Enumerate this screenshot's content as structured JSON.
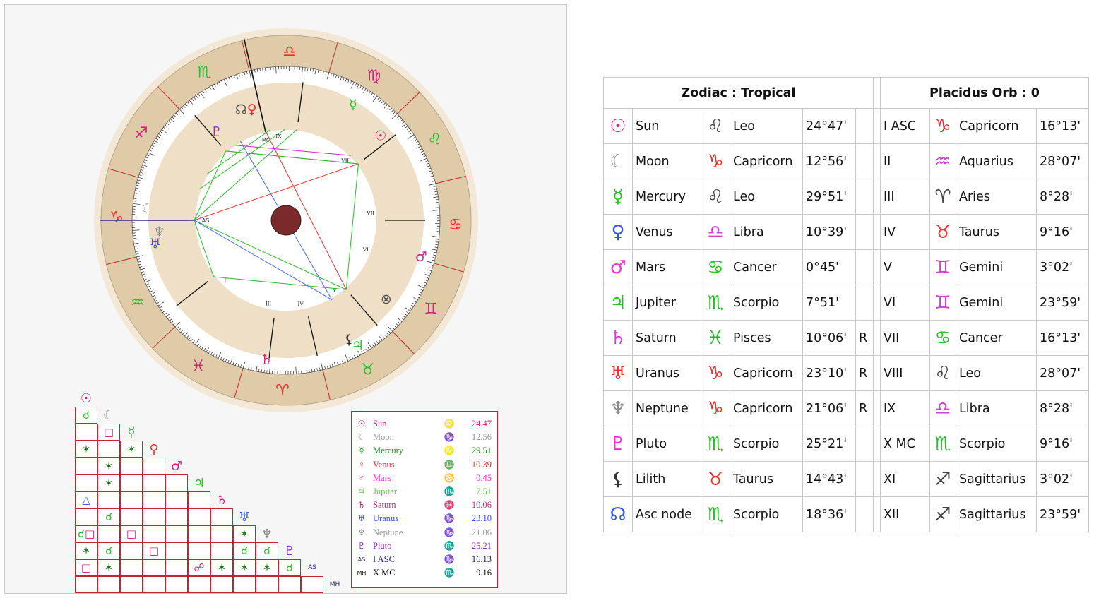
{
  "colors": {
    "wheel_outer_bg": "#f3e8d6",
    "sign_band": "#e0cba8",
    "house_band": "#eedfc6",
    "inner_circle": "#ffffff",
    "grid_red": "#c0282d",
    "center_ball": "#7a2a2a"
  },
  "wheel": {
    "house_labels": [
      "II",
      "III",
      "IV",
      "V",
      "VI",
      "VII",
      "VIII",
      "IX"
    ],
    "ascendant_label": "AS",
    "midheaven_label": "MC",
    "signs": [
      {
        "name": "Libra",
        "glyph": "♎",
        "color": "#e8302e"
      },
      {
        "name": "Virgo",
        "glyph": "♍",
        "color": "#d2207a"
      },
      {
        "name": "Leo",
        "glyph": "♌",
        "color": "#2dbb2d"
      },
      {
        "name": "Cancer",
        "glyph": "♋",
        "color": "#e8302e"
      },
      {
        "name": "Gemini",
        "glyph": "♊",
        "color": "#d2207a"
      },
      {
        "name": "Taurus",
        "glyph": "♉",
        "color": "#2dbb2d"
      },
      {
        "name": "Aries",
        "glyph": "♈",
        "color": "#e8302e"
      },
      {
        "name": "Pisces",
        "glyph": "♓",
        "color": "#d2207a"
      },
      {
        "name": "Aquarius",
        "glyph": "♒",
        "color": "#2dbb2d"
      },
      {
        "name": "Capricorn",
        "glyph": "♑",
        "color": "#e8302e"
      },
      {
        "name": "Sagittarius",
        "glyph": "♐",
        "color": "#d2207a"
      },
      {
        "name": "Scorpio",
        "glyph": "♏",
        "color": "#2dbb2d"
      }
    ],
    "planet_glyphs": [
      {
        "name": "Venus",
        "glyph": "♀",
        "color": "#e8302e"
      },
      {
        "name": "Pluto",
        "glyph": "♇",
        "color": "#8b2fc9"
      },
      {
        "name": "Asc node",
        "glyph": "☊",
        "color": "#555555"
      },
      {
        "name": "Mercury",
        "glyph": "☿",
        "color": "#2dbb2d"
      },
      {
        "name": "Sun",
        "glyph": "☉",
        "color": "#d2207a"
      },
      {
        "name": "Moon",
        "glyph": "☾",
        "color": "#999999"
      },
      {
        "name": "Uranus",
        "glyph": "♅",
        "color": "#3355ff"
      },
      {
        "name": "Neptune",
        "glyph": "♆",
        "color": "#888888"
      },
      {
        "name": "Mars",
        "glyph": "♂",
        "color": "#d2207a"
      },
      {
        "name": "Saturn",
        "glyph": "♄",
        "color": "#d2207a"
      },
      {
        "name": "Lilith",
        "glyph": "⚸",
        "color": "#333333"
      },
      {
        "name": "Jupiter",
        "glyph": "♃",
        "color": "#2dbb2d"
      },
      {
        "name": "Fortune",
        "glyph": "⊗",
        "color": "#555555"
      }
    ]
  },
  "aspect_grid": {
    "headers": [
      {
        "glyph": "☉",
        "color": "#d2207a"
      },
      {
        "glyph": "☾",
        "color": "#999999"
      },
      {
        "glyph": "☿",
        "color": "#2dbb2d"
      },
      {
        "glyph": "♀",
        "color": "#e8302e"
      },
      {
        "glyph": "♂",
        "color": "#d2207a"
      },
      {
        "glyph": "♃",
        "color": "#2dbb2d"
      },
      {
        "glyph": "♄",
        "color": "#d2207a"
      },
      {
        "glyph": "♅",
        "color": "#3355ff"
      },
      {
        "glyph": "♆",
        "color": "#888888"
      },
      {
        "glyph": "♇",
        "color": "#8b2fc9"
      },
      {
        "glyph": "AS",
        "color": "#24246e"
      },
      {
        "glyph": "MH",
        "color": "#24246e"
      }
    ],
    "aspects": [
      {
        "row": 1,
        "col": 0,
        "glyph": "☌",
        "color": "#2dbb2d"
      },
      {
        "row": 2,
        "col": 1,
        "glyph": "□",
        "color": "#d2207a"
      },
      {
        "row": 3,
        "col": 0,
        "glyph": "✶",
        "color": "#1d7a1d"
      },
      {
        "row": 3,
        "col": 2,
        "glyph": "✶",
        "color": "#1d7a1d"
      },
      {
        "row": 4,
        "col": 1,
        "glyph": "✶",
        "color": "#1d7a1d"
      },
      {
        "row": 5,
        "col": 1,
        "glyph": "✶",
        "color": "#1d7a1d"
      },
      {
        "row": 5,
        "col": 5,
        "glyph": "△",
        "color": "#3355ff"
      },
      {
        "row": 7,
        "col": 1,
        "glyph": "☌",
        "color": "#2dbb2d"
      },
      {
        "row": 7,
        "col": 7,
        "glyph": "☌",
        "color": "#2dbb2d"
      },
      {
        "row": 8,
        "col": 0,
        "glyph": "□",
        "color": "#d2207a"
      },
      {
        "row": 8,
        "col": 2,
        "glyph": "□",
        "color": "#d2207a"
      },
      {
        "row": 8,
        "col": 7,
        "glyph": "✶",
        "color": "#1d7a1d"
      },
      {
        "row": 8,
        "col": 8,
        "glyph": "✶",
        "color": "#1d7a1d"
      },
      {
        "row": 9,
        "col": 1,
        "glyph": "☌",
        "color": "#2dbb2d"
      },
      {
        "row": 9,
        "col": 3,
        "glyph": "□",
        "color": "#d2207a"
      },
      {
        "row": 9,
        "col": 7,
        "glyph": "☌",
        "color": "#2dbb2d"
      },
      {
        "row": 9,
        "col": 8,
        "glyph": "☌",
        "color": "#2dbb2d"
      },
      {
        "row": 10,
        "col": 0,
        "glyph": "□",
        "color": "#d2207a"
      },
      {
        "row": 10,
        "col": 1,
        "glyph": "✶",
        "color": "#1d7a1d"
      },
      {
        "row": 10,
        "col": 5,
        "glyph": "☍",
        "color": "#d2207a"
      },
      {
        "row": 10,
        "col": 6,
        "glyph": "✶",
        "color": "#1d7a1d"
      },
      {
        "row": 10,
        "col": 7,
        "glyph": "✶",
        "color": "#1d7a1d"
      },
      {
        "row": 10,
        "col": 8,
        "glyph": "✶",
        "color": "#1d7a1d"
      },
      {
        "row": 10,
        "col": 9,
        "glyph": "☌",
        "color": "#2dbb2d"
      }
    ]
  },
  "legend": [
    {
      "sym": "☉",
      "sym_color": "#d2207a",
      "name": "Sun",
      "name_color": "#d2207a",
      "sign": "♌",
      "sign_color": "#d2207a",
      "value": "24.47",
      "value_color": "#d2207a"
    },
    {
      "sym": "☾",
      "sym_color": "#999999",
      "name": "Moon",
      "name_color": "#999999",
      "sign": "♑",
      "sign_color": "#999999",
      "value": "12.56",
      "value_color": "#999999"
    },
    {
      "sym": "☿",
      "sym_color": "#2dbb2d",
      "name": "Mercury",
      "name_color": "#1d8a1d",
      "sign": "♌",
      "sign_color": "#1d8a1d",
      "value": "29.51",
      "value_color": "#1d8a1d"
    },
    {
      "sym": "♀",
      "sym_color": "#e8302e",
      "name": "Venus",
      "name_color": "#e8302e",
      "sign": "♎",
      "sign_color": "#e8302e",
      "value": "10.39",
      "value_color": "#e8302e"
    },
    {
      "sym": "♂",
      "sym_color": "#ee33cc",
      "name": "Mars",
      "name_color": "#ee33cc",
      "sign": "♋",
      "sign_color": "#ee33cc",
      "value": "0.45",
      "value_color": "#ee33cc"
    },
    {
      "sym": "♃",
      "sym_color": "#5dcc3d",
      "name": "Jupiter",
      "name_color": "#5dcc3d",
      "sign": "♏",
      "sign_color": "#5dcc3d",
      "value": "7.51",
      "value_color": "#5dcc3d"
    },
    {
      "sym": "♄",
      "sym_color": "#d2207a",
      "name": "Saturn",
      "name_color": "#d2207a",
      "sign": "♓",
      "sign_color": "#d2207a",
      "value": "10.06",
      "value_color": "#d2207a"
    },
    {
      "sym": "♅",
      "sym_color": "#3355ff",
      "name": "Uranus",
      "name_color": "#3355ff",
      "sign": "♑",
      "sign_color": "#3355ff",
      "value": "23.10",
      "value_color": "#3355ff"
    },
    {
      "sym": "♆",
      "sym_color": "#999999",
      "name": "Neptune",
      "name_color": "#999999",
      "sign": "♑",
      "sign_color": "#999999",
      "value": "21.06",
      "value_color": "#999999"
    },
    {
      "sym": "♇",
      "sym_color": "#8b2fc9",
      "name": "Pluto",
      "name_color": "#8b2fc9",
      "sign": "♏",
      "sign_color": "#8b2fc9",
      "value": "25.21",
      "value_color": "#8b2fc9"
    },
    {
      "sym": "AS",
      "sym_color": "#24246e",
      "name": "I ASC",
      "name_color": "#24246e",
      "sign": "♑",
      "sign_color": "#24246e",
      "value": "16.13",
      "value_color": "#24246e"
    },
    {
      "sym": "MH",
      "sym_color": "#111111",
      "name": "X MC",
      "name_color": "#111111",
      "sign": "♏",
      "sign_color": "#111111",
      "value": "9.16",
      "value_color": "#111111"
    }
  ],
  "table": {
    "zodiac_header": "Zodiac : Tropical",
    "houses_header": "Placidus Orb : 0",
    "rows": [
      {
        "p_glyph": "☉",
        "p_color": "#d2207a",
        "planet": "Sun",
        "s_glyph": "♌",
        "s_color": "#444444",
        "sign": "Leo",
        "deg": "24°47'",
        "retro": "",
        "house": "I ASC",
        "h_glyph": "♑",
        "h_color": "#e8302e",
        "h_sign": "Capricorn",
        "h_deg": "16°13'"
      },
      {
        "p_glyph": "☾",
        "p_color": "#999999",
        "planet": "Moon",
        "s_glyph": "♑",
        "s_color": "#e8302e",
        "sign": "Capricorn",
        "deg": "12°56'",
        "retro": "",
        "house": "II",
        "h_glyph": "♒",
        "h_color": "#cc44cc",
        "h_sign": "Aquarius",
        "h_deg": "28°07'"
      },
      {
        "p_glyph": "☿",
        "p_color": "#2dbb2d",
        "planet": "Mercury",
        "s_glyph": "♌",
        "s_color": "#444444",
        "sign": "Leo",
        "deg": "29°51'",
        "retro": "",
        "house": "III",
        "h_glyph": "♈",
        "h_color": "#444444",
        "h_sign": "Aries",
        "h_deg": "8°28'"
      },
      {
        "p_glyph": "♀",
        "p_color": "#3355ff",
        "planet": "Venus",
        "s_glyph": "♎",
        "s_color": "#cc44cc",
        "sign": "Libra",
        "deg": "10°39'",
        "retro": "",
        "house": "IV",
        "h_glyph": "♉",
        "h_color": "#e8302e",
        "h_sign": "Taurus",
        "h_deg": "9°16'"
      },
      {
        "p_glyph": "♂",
        "p_color": "#ee33cc",
        "planet": "Mars",
        "s_glyph": "♋",
        "s_color": "#2dbb2d",
        "sign": "Cancer",
        "deg": "0°45'",
        "retro": "",
        "house": "V",
        "h_glyph": "♊",
        "h_color": "#cc44cc",
        "h_sign": "Gemini",
        "h_deg": "3°02'"
      },
      {
        "p_glyph": "♃",
        "p_color": "#2dbb2d",
        "planet": "Jupiter",
        "s_glyph": "♏",
        "s_color": "#2dbb2d",
        "sign": "Scorpio",
        "deg": "7°51'",
        "retro": "",
        "house": "VI",
        "h_glyph": "♊",
        "h_color": "#cc44cc",
        "h_sign": "Gemini",
        "h_deg": "23°59'"
      },
      {
        "p_glyph": "♄",
        "p_color": "#cc44cc",
        "planet": "Saturn",
        "s_glyph": "♓",
        "s_color": "#2dbb2d",
        "sign": "Pisces",
        "deg": "10°06'",
        "retro": "R",
        "house": "VII",
        "h_glyph": "♋",
        "h_color": "#2dbb2d",
        "h_sign": "Cancer",
        "h_deg": "16°13'"
      },
      {
        "p_glyph": "♅",
        "p_color": "#e8302e",
        "planet": "Uranus",
        "s_glyph": "♑",
        "s_color": "#e8302e",
        "sign": "Capricorn",
        "deg": "23°10'",
        "retro": "R",
        "house": "VIII",
        "h_glyph": "♌",
        "h_color": "#444444",
        "h_sign": "Leo",
        "h_deg": "28°07'"
      },
      {
        "p_glyph": "♆",
        "p_color": "#888888",
        "planet": "Neptune",
        "s_glyph": "♑",
        "s_color": "#e8302e",
        "sign": "Capricorn",
        "deg": "21°06'",
        "retro": "R",
        "house": "IX",
        "h_glyph": "♎",
        "h_color": "#cc44cc",
        "h_sign": "Libra",
        "h_deg": "8°28'"
      },
      {
        "p_glyph": "♇",
        "p_color": "#ee33cc",
        "planet": "Pluto",
        "s_glyph": "♏",
        "s_color": "#2dbb2d",
        "sign": "Scorpio",
        "deg": "25°21'",
        "retro": "",
        "house": "X MC",
        "h_glyph": "♏",
        "h_color": "#2dbb2d",
        "h_sign": "Scorpio",
        "h_deg": "9°16'"
      },
      {
        "p_glyph": "⚸",
        "p_color": "#333333",
        "planet": "Lilith",
        "s_glyph": "♉",
        "s_color": "#e8302e",
        "sign": "Taurus",
        "deg": "14°43'",
        "retro": "",
        "house": "XI",
        "h_glyph": "♐",
        "h_color": "#444444",
        "h_sign": "Sagittarius",
        "h_deg": "3°02'"
      },
      {
        "p_glyph": "☊",
        "p_color": "#3355ff",
        "planet": "Asc node",
        "s_glyph": "♏",
        "s_color": "#2dbb2d",
        "sign": "Scorpio",
        "deg": "18°36'",
        "retro": "",
        "house": "XII",
        "h_glyph": "♐",
        "h_color": "#444444",
        "h_sign": "Sagittarius",
        "h_deg": "23°59'"
      }
    ]
  }
}
